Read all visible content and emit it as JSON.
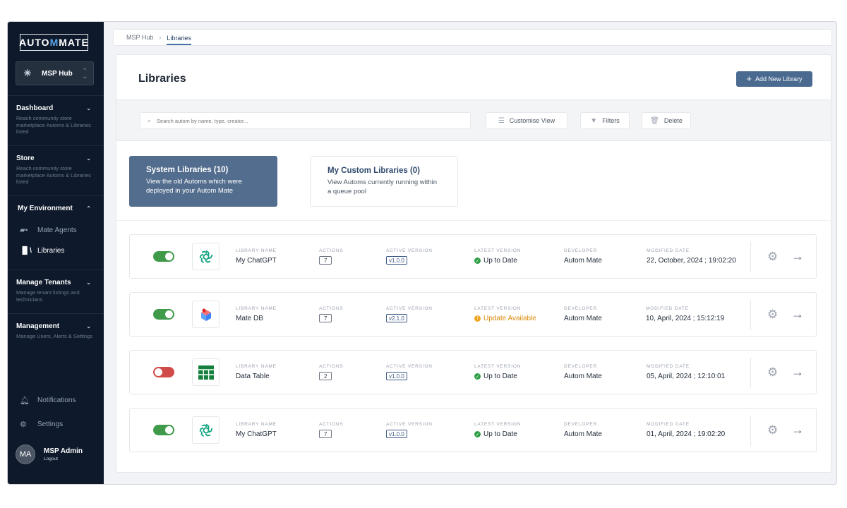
{
  "sidebar": {
    "logo_prefix": "AUTO",
    "logo_m": "M",
    "logo_suffix": "MATE",
    "hub": {
      "label": "MSP Hub",
      "icon": "hub-icon"
    },
    "sections": [
      {
        "title": "Dashboard",
        "desc": "Reach community store marketplace Automs & Libraries listed"
      },
      {
        "title": "Store",
        "desc": "Reach community store marketplace Automs & Libraries listed"
      },
      {
        "title": "My Environment",
        "items": [
          {
            "label": "Mate Agents",
            "icon": "agents-icon"
          },
          {
            "label": "Libraries",
            "icon": "libraries-icon"
          }
        ]
      },
      {
        "title": "Manage Tenants",
        "desc": "Manage tenant listings and technicians"
      },
      {
        "title": "Management",
        "desc": "Manage Users, Alerts & Settings"
      }
    ],
    "bottom": {
      "notifications": "Notifications",
      "settings": "Settings"
    },
    "user": {
      "initials": "MA",
      "name": "MSP Admin",
      "logout": "Logout"
    }
  },
  "breadcrumb": {
    "root": "MSP Hub",
    "current": "Libraries"
  },
  "page": {
    "title": "Libraries",
    "add_button": "Add New Library"
  },
  "toolbar": {
    "search_placeholder": "Search autom by name, type, creator...",
    "customise": "Customise View",
    "filters": "Filters",
    "delete": "Delete"
  },
  "tabs": [
    {
      "title": "System Libraries (10)",
      "desc": "View the old Automs which were deployed in your Autom Mate"
    },
    {
      "title": "My Custom Libraries (0)",
      "desc": "View Automs currently running within a queue pool"
    }
  ],
  "columns": {
    "name": "LIBRARY NAME",
    "actions": "ACTIONS",
    "active_version": "ACTIVE VERSION",
    "latest_version": "LATEST VERSION",
    "developer": "DEVELOPER",
    "modified": "MODIFIED DATE"
  },
  "libraries": [
    {
      "name": "My ChatGPT",
      "actions": "7",
      "active_version": "v1.0.0",
      "latest_status": "Up to Date",
      "developer": "Autom Mate",
      "modified": "22, October, 2024 ; 19:02:20",
      "enabled": true,
      "icon": "chatgpt-icon"
    },
    {
      "name": "Mate DB",
      "actions": "7",
      "active_version": "v2.1.0",
      "latest_status": "Update Available",
      "developer": "Autom Mate",
      "modified": "10, April, 2024 ; 15:12:19",
      "enabled": true,
      "icon": "database-icon"
    },
    {
      "name": "Data Table",
      "actions": "2",
      "active_version": "v1.0.0",
      "latest_status": "Up to Date",
      "developer": "Autom Mate",
      "modified": "05, April, 2024 ; 12:10:01",
      "enabled": false,
      "icon": "table-icon"
    },
    {
      "name": "My ChatGPT",
      "actions": "7",
      "active_version": "v1.0.0",
      "latest_status": "Up to Date",
      "developer": "Autom Mate",
      "modified": "01, April, 2024 ; 19:02:20",
      "enabled": true,
      "icon": "chatgpt-icon"
    }
  ],
  "colors": {
    "sidebar_bg": "#0e1a2b",
    "accent": "#4a6a90",
    "toggle_on": "#3f9b4a",
    "toggle_off": "#d14b4b",
    "status_ok": "#2e9e46",
    "status_warn": "#f0a622"
  }
}
